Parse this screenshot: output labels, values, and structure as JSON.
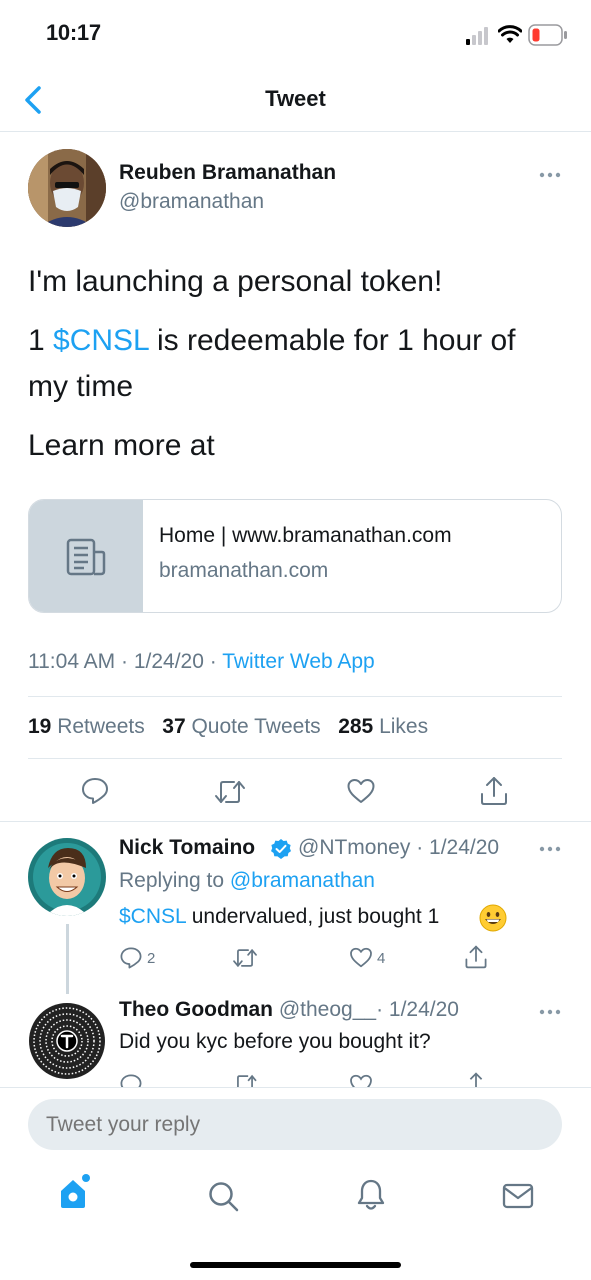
{
  "status_bar": {
    "time": "10:17"
  },
  "header": {
    "title": "Tweet"
  },
  "tweet": {
    "author_name": "Reuben Bramanathan",
    "author_handle": "@bramanathan",
    "line1": "I'm launching a personal token!",
    "line2_prefix": "1 ",
    "cashtag": "$CNSL",
    "line2_suffix": " is redeemable for 1 hour of",
    "line3": "my time",
    "line4": "Learn more at",
    "card": {
      "title": "Home | www.bramanathan.com",
      "domain": "bramanathan.com"
    },
    "time": "11:04 AM",
    "date": "1/24/20",
    "source": "Twitter Web App",
    "meta_sep": " · ",
    "stats": {
      "retweets": "19",
      "retweets_label": "Retweets",
      "quotes": "37",
      "quotes_label": "Quote Tweets",
      "likes": "285",
      "likes_label": "Likes"
    }
  },
  "replies": [
    {
      "name": "Nick Tomaino",
      "handle": "@NTmoney",
      "date": "· 1/24/20",
      "replying_prefix": "Replying to",
      "replying_handle": "@bramanathan",
      "cashtag": "$CNSL",
      "text": " undervalued, just bought 1",
      "emoji": "😀",
      "reply_count": "2",
      "like_count": "4"
    },
    {
      "name": "Theo Goodman",
      "handle": "@theog__",
      "date": "· 1/24/20",
      "text": "Did you kyc before you bought it?"
    }
  ],
  "composer": {
    "placeholder": "Tweet your reply"
  },
  "colors": {
    "accent": "#1da1f2",
    "muted": "#657786",
    "divider": "#e1e8ed"
  },
  "icons": [
    "back-chevron-icon",
    "more-icon",
    "reply-icon",
    "retweet-icon",
    "like-icon",
    "share-icon",
    "home-icon",
    "search-icon",
    "notifications-icon",
    "messages-icon",
    "verified-badge-icon",
    "article-icon"
  ]
}
